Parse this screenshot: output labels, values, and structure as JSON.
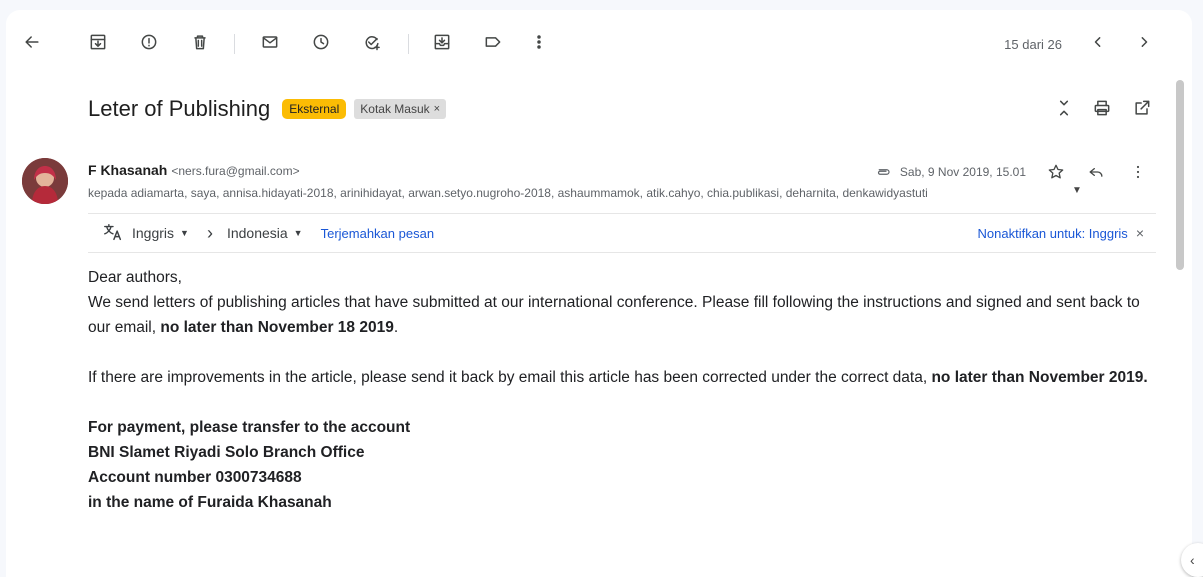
{
  "toolbar": {
    "pager": "15 dari 26"
  },
  "email": {
    "subject": "Leter of Publishing",
    "labels": {
      "external": "Eksternal",
      "inbox": "Kotak Masuk",
      "inbox_remove": "×"
    },
    "sender": {
      "name": "F Khasanah",
      "email": "<ners.fura@gmail.com>",
      "date": "Sab, 9 Nov 2019, 15.01"
    },
    "recipients": "kepada adiamarta, saya, annisa.hidayati-2018, arinihidayat, arwan.setyo.nugroho-2018, ashaummamok, atik.cahyo, chia.publikasi, deharnita, denkawidyastuti",
    "translation": {
      "from_lang": "Inggris",
      "to_lang": "Indonesia",
      "translate_link": "Terjemahkan pesan",
      "disable": "Nonaktifkan untuk: Inggris",
      "close": "×"
    },
    "body": {
      "greeting": "Dear authors,",
      "p1_text": "We send letters of publishing articles that have submitted at our international conference. Please fill following the instructions and signed and sent back to our email, ",
      "p1_bold": "no later than November 18 2019",
      "p1_end": ".",
      "p2_text": "If there are improvements in the article, please send it back by email this article has been corrected under the correct data, ",
      "p2_bold": "no later than November 2019.",
      "pay1": "For payment, please transfer to the account",
      "pay2": "BNI Slamet Riyadi Solo Branch Office",
      "pay3": "Account number 0300734688",
      "pay4": "in the name of Furaida Khasanah"
    }
  },
  "colors": {
    "external_badge": "#fbbc04",
    "link": "#1a57d6"
  }
}
